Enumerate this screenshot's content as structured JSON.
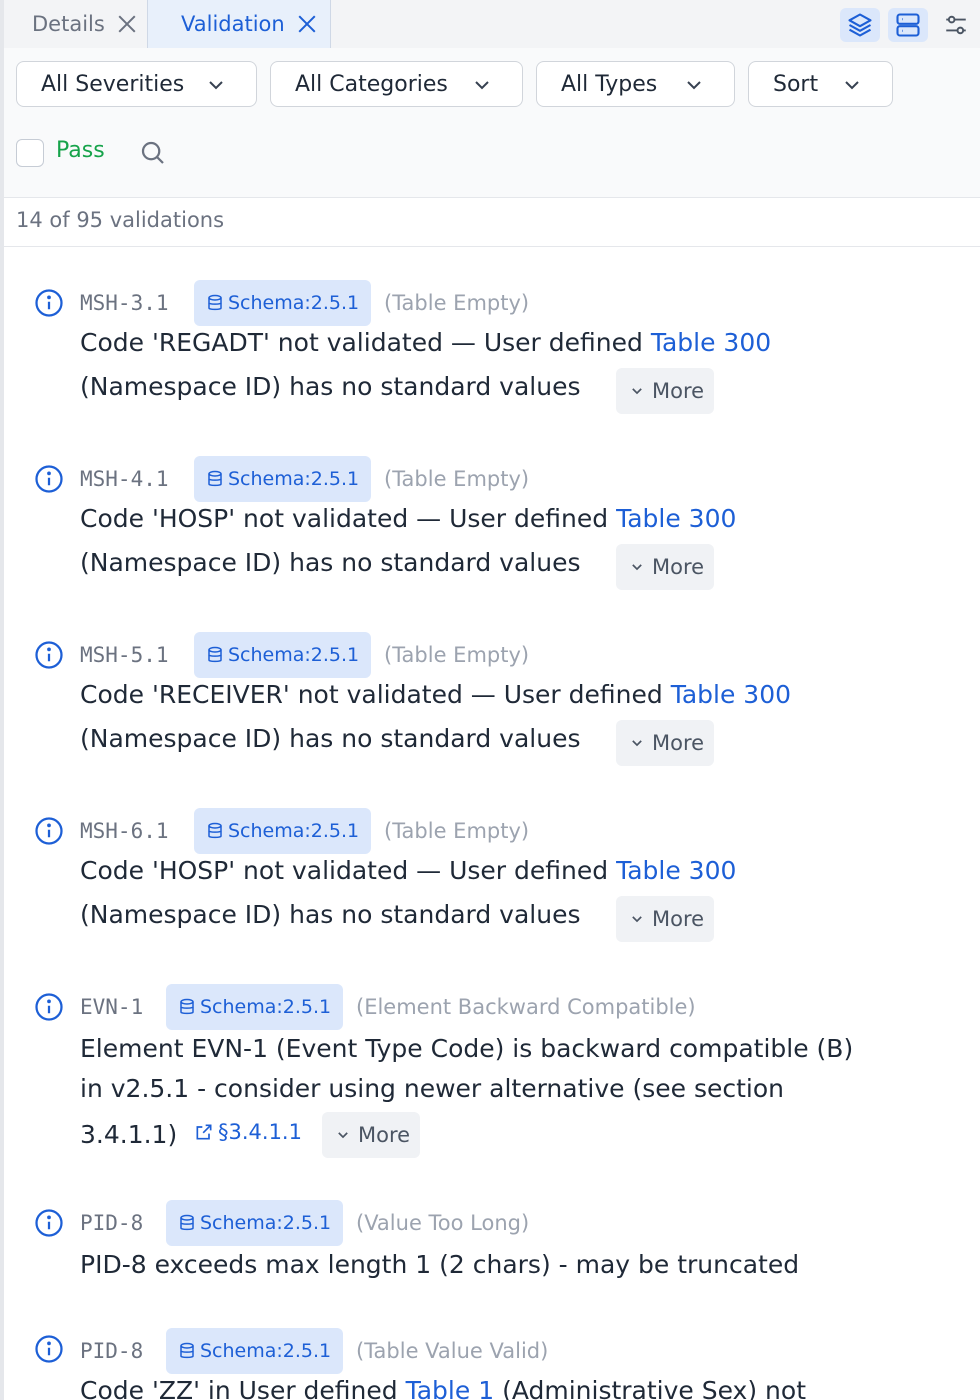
{
  "tabs": [
    {
      "label": "Details"
    },
    {
      "label": "Validation"
    }
  ],
  "filters": {
    "severity": "All Severities",
    "category": "All Categories",
    "type": "All Types",
    "sort": "Sort",
    "pass_label": "Pass"
  },
  "count_text": "14 of 95 validations",
  "more_label": "More",
  "items": [
    {
      "field": "MSH-3.1",
      "schema": "Schema:2.5.1",
      "category": "(Table Empty)",
      "line1_pre": "Code 'REGADT' not validated — User defined ",
      "line1_link": "Table 300",
      "line2": "(Namespace ID) has no standard values"
    },
    {
      "field": "MSH-4.1",
      "schema": "Schema:2.5.1",
      "category": "(Table Empty)",
      "line1_pre": "Code 'HOSP' not validated — User defined ",
      "line1_link": "Table 300",
      "line2": "(Namespace ID) has no standard values"
    },
    {
      "field": "MSH-5.1",
      "schema": "Schema:2.5.1",
      "category": "(Table Empty)",
      "line1_pre": "Code 'RECEIVER' not validated — User defined ",
      "line1_link": "Table 300",
      "line2": "(Namespace ID) has no standard values"
    },
    {
      "field": "MSH-6.1",
      "schema": "Schema:2.5.1",
      "category": "(Table Empty)",
      "line1_pre": "Code 'HOSP' not validated — User defined ",
      "line1_link": "Table 300",
      "line2": "(Namespace ID) has no standard values"
    },
    {
      "field": "EVN-1",
      "schema": "Schema:2.5.1",
      "category": "(Element Backward Compatible)",
      "line1": "Element EVN-1 (Event Type Code) is backward compatible (B)",
      "line2": "in v2.5.1 - consider using newer alternative (see section",
      "line3": "3.4.1.1)",
      "section_link": "§3.4.1.1"
    },
    {
      "field": "PID-8",
      "schema": "Schema:2.5.1",
      "category": "(Value Too Long)",
      "line1": "PID-8 exceeds max length 1 (2 chars) - may be truncated"
    },
    {
      "field": "PID-8",
      "schema": "Schema:2.5.1",
      "category": "(Table Value Valid)",
      "line1_pre": "Code 'ZZ' in User defined ",
      "line1_link": "Table 1",
      "line1_post": " (Administrative Sex) not"
    }
  ]
}
